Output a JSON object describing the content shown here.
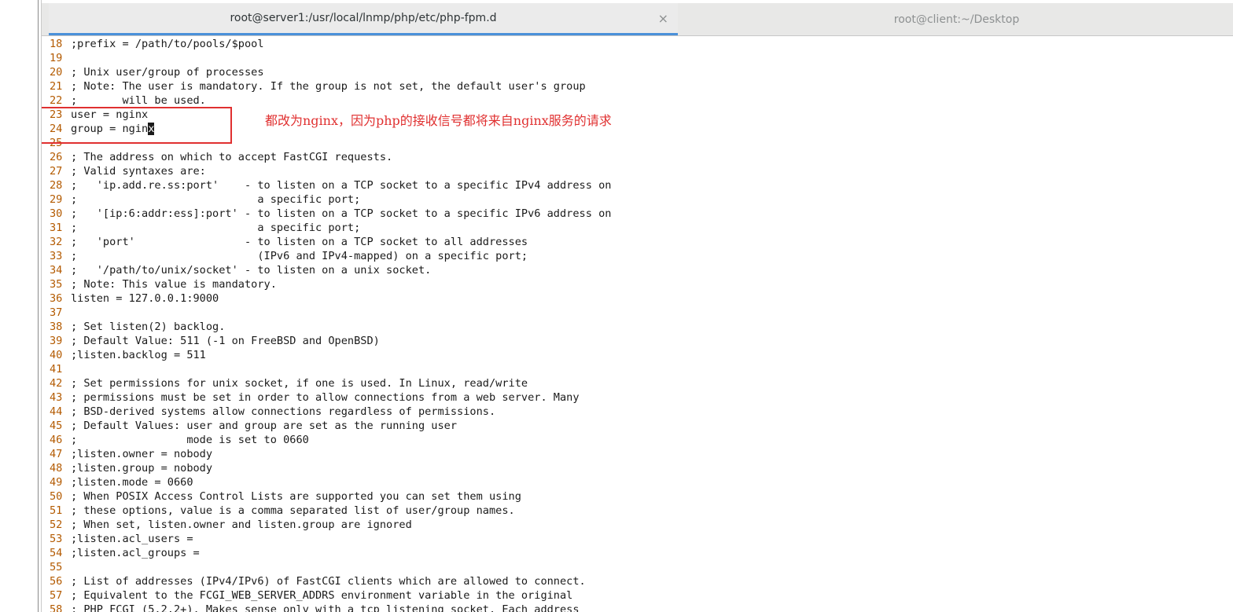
{
  "tabs": [
    {
      "label": "root@server1:/usr/local/lnmp/php/etc/php-fpm.d",
      "active": true
    },
    {
      "label": "root@client:~/Desktop",
      "active": false
    }
  ],
  "close_glyph": "×",
  "annotation": "都改为nginx，因为php的接收信号都将来自nginx服务的请求",
  "lines": [
    {
      "n": "18",
      "t": ";prefix = /path/to/pools/$pool"
    },
    {
      "n": "19",
      "t": ""
    },
    {
      "n": "20",
      "t": "; Unix user/group of processes"
    },
    {
      "n": "21",
      "t": "; Note: The user is mandatory. If the group is not set, the default user's group"
    },
    {
      "n": "22",
      "t": ";       will be used."
    },
    {
      "n": "23",
      "t": "user = nginx"
    },
    {
      "n": "24",
      "t": "group = ngin",
      "cursor": "x"
    },
    {
      "n": "25",
      "t": ""
    },
    {
      "n": "26",
      "t": "; The address on which to accept FastCGI requests."
    },
    {
      "n": "27",
      "t": "; Valid syntaxes are:"
    },
    {
      "n": "28",
      "t": ";   'ip.add.re.ss:port'    - to listen on a TCP socket to a specific IPv4 address on"
    },
    {
      "n": "29",
      "t": ";                            a specific port;"
    },
    {
      "n": "30",
      "t": ";   '[ip:6:addr:ess]:port' - to listen on a TCP socket to a specific IPv6 address on"
    },
    {
      "n": "31",
      "t": ";                            a specific port;"
    },
    {
      "n": "32",
      "t": ";   'port'                 - to listen on a TCP socket to all addresses"
    },
    {
      "n": "33",
      "t": ";                            (IPv6 and IPv4-mapped) on a specific port;"
    },
    {
      "n": "34",
      "t": ";   '/path/to/unix/socket' - to listen on a unix socket."
    },
    {
      "n": "35",
      "t": "; Note: This value is mandatory."
    },
    {
      "n": "36",
      "t": "listen = 127.0.0.1:9000"
    },
    {
      "n": "37",
      "t": ""
    },
    {
      "n": "38",
      "t": "; Set listen(2) backlog."
    },
    {
      "n": "39",
      "t": "; Default Value: 511 (-1 on FreeBSD and OpenBSD)"
    },
    {
      "n": "40",
      "t": ";listen.backlog = 511"
    },
    {
      "n": "41",
      "t": ""
    },
    {
      "n": "42",
      "t": "; Set permissions for unix socket, if one is used. In Linux, read/write"
    },
    {
      "n": "43",
      "t": "; permissions must be set in order to allow connections from a web server. Many"
    },
    {
      "n": "44",
      "t": "; BSD-derived systems allow connections regardless of permissions."
    },
    {
      "n": "45",
      "t": "; Default Values: user and group are set as the running user"
    },
    {
      "n": "46",
      "t": ";                 mode is set to 0660"
    },
    {
      "n": "47",
      "t": ";listen.owner = nobody"
    },
    {
      "n": "48",
      "t": ";listen.group = nobody"
    },
    {
      "n": "49",
      "t": ";listen.mode = 0660"
    },
    {
      "n": "50",
      "t": "; When POSIX Access Control Lists are supported you can set them using"
    },
    {
      "n": "51",
      "t": "; these options, value is a comma separated list of user/group names."
    },
    {
      "n": "52",
      "t": "; When set, listen.owner and listen.group are ignored"
    },
    {
      "n": "53",
      "t": ";listen.acl_users ="
    },
    {
      "n": "54",
      "t": ";listen.acl_groups ="
    },
    {
      "n": "55",
      "t": ""
    },
    {
      "n": "56",
      "t": "; List of addresses (IPv4/IPv6) of FastCGI clients which are allowed to connect."
    },
    {
      "n": "57",
      "t": "; Equivalent to the FCGI_WEB_SERVER_ADDRS environment variable in the original"
    },
    {
      "n": "58",
      "t": "; PHP FCGI (5.2.2+). Makes sense only with a tcp listening socket. Each address"
    }
  ]
}
